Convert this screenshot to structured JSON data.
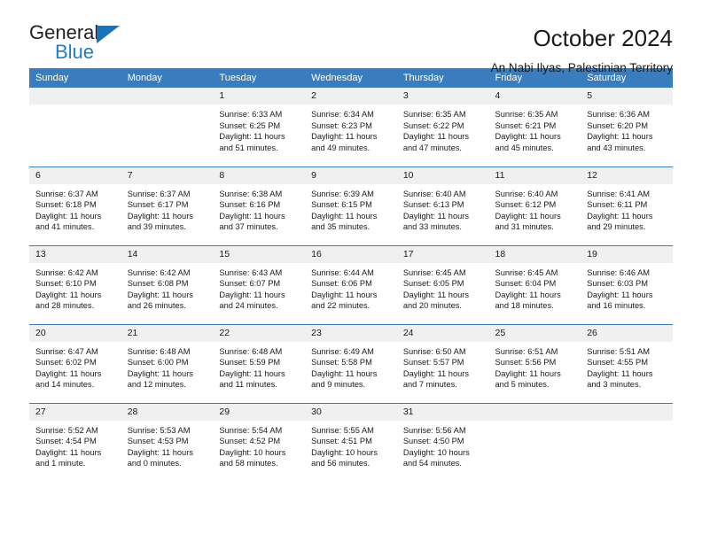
{
  "logo": {
    "word_one": "General",
    "word_two": "Blue",
    "triangle_icon": "blue-triangle-icon"
  },
  "header": {
    "title": "October 2024",
    "subtitle": "An Nabi Ilyas, Palestinian Territory"
  },
  "colors": {
    "header_blue": "#3a7dbf",
    "logo_blue": "#1f7dc4",
    "daynum_band": "#f0f0f0",
    "text": "#1a1a1a"
  },
  "weekday_headers": [
    "Sunday",
    "Monday",
    "Tuesday",
    "Wednesday",
    "Thursday",
    "Friday",
    "Saturday"
  ],
  "weeks": [
    [
      {
        "day": "",
        "info": ""
      },
      {
        "day": "",
        "info": ""
      },
      {
        "day": "1",
        "info": "Sunrise: 6:33 AM\nSunset: 6:25 PM\nDaylight: 11 hours\nand 51 minutes."
      },
      {
        "day": "2",
        "info": "Sunrise: 6:34 AM\nSunset: 6:23 PM\nDaylight: 11 hours\nand 49 minutes."
      },
      {
        "day": "3",
        "info": "Sunrise: 6:35 AM\nSunset: 6:22 PM\nDaylight: 11 hours\nand 47 minutes."
      },
      {
        "day": "4",
        "info": "Sunrise: 6:35 AM\nSunset: 6:21 PM\nDaylight: 11 hours\nand 45 minutes."
      },
      {
        "day": "5",
        "info": "Sunrise: 6:36 AM\nSunset: 6:20 PM\nDaylight: 11 hours\nand 43 minutes."
      }
    ],
    [
      {
        "day": "6",
        "info": "Sunrise: 6:37 AM\nSunset: 6:18 PM\nDaylight: 11 hours\nand 41 minutes."
      },
      {
        "day": "7",
        "info": "Sunrise: 6:37 AM\nSunset: 6:17 PM\nDaylight: 11 hours\nand 39 minutes."
      },
      {
        "day": "8",
        "info": "Sunrise: 6:38 AM\nSunset: 6:16 PM\nDaylight: 11 hours\nand 37 minutes."
      },
      {
        "day": "9",
        "info": "Sunrise: 6:39 AM\nSunset: 6:15 PM\nDaylight: 11 hours\nand 35 minutes."
      },
      {
        "day": "10",
        "info": "Sunrise: 6:40 AM\nSunset: 6:13 PM\nDaylight: 11 hours\nand 33 minutes."
      },
      {
        "day": "11",
        "info": "Sunrise: 6:40 AM\nSunset: 6:12 PM\nDaylight: 11 hours\nand 31 minutes."
      },
      {
        "day": "12",
        "info": "Sunrise: 6:41 AM\nSunset: 6:11 PM\nDaylight: 11 hours\nand 29 minutes."
      }
    ],
    [
      {
        "day": "13",
        "info": "Sunrise: 6:42 AM\nSunset: 6:10 PM\nDaylight: 11 hours\nand 28 minutes."
      },
      {
        "day": "14",
        "info": "Sunrise: 6:42 AM\nSunset: 6:08 PM\nDaylight: 11 hours\nand 26 minutes."
      },
      {
        "day": "15",
        "info": "Sunrise: 6:43 AM\nSunset: 6:07 PM\nDaylight: 11 hours\nand 24 minutes."
      },
      {
        "day": "16",
        "info": "Sunrise: 6:44 AM\nSunset: 6:06 PM\nDaylight: 11 hours\nand 22 minutes."
      },
      {
        "day": "17",
        "info": "Sunrise: 6:45 AM\nSunset: 6:05 PM\nDaylight: 11 hours\nand 20 minutes."
      },
      {
        "day": "18",
        "info": "Sunrise: 6:45 AM\nSunset: 6:04 PM\nDaylight: 11 hours\nand 18 minutes."
      },
      {
        "day": "19",
        "info": "Sunrise: 6:46 AM\nSunset: 6:03 PM\nDaylight: 11 hours\nand 16 minutes."
      }
    ],
    [
      {
        "day": "20",
        "info": "Sunrise: 6:47 AM\nSunset: 6:02 PM\nDaylight: 11 hours\nand 14 minutes."
      },
      {
        "day": "21",
        "info": "Sunrise: 6:48 AM\nSunset: 6:00 PM\nDaylight: 11 hours\nand 12 minutes."
      },
      {
        "day": "22",
        "info": "Sunrise: 6:48 AM\nSunset: 5:59 PM\nDaylight: 11 hours\nand 11 minutes."
      },
      {
        "day": "23",
        "info": "Sunrise: 6:49 AM\nSunset: 5:58 PM\nDaylight: 11 hours\nand 9 minutes."
      },
      {
        "day": "24",
        "info": "Sunrise: 6:50 AM\nSunset: 5:57 PM\nDaylight: 11 hours\nand 7 minutes."
      },
      {
        "day": "25",
        "info": "Sunrise: 6:51 AM\nSunset: 5:56 PM\nDaylight: 11 hours\nand 5 minutes."
      },
      {
        "day": "26",
        "info": "Sunrise: 5:51 AM\nSunset: 4:55 PM\nDaylight: 11 hours\nand 3 minutes."
      }
    ],
    [
      {
        "day": "27",
        "info": "Sunrise: 5:52 AM\nSunset: 4:54 PM\nDaylight: 11 hours\nand 1 minute."
      },
      {
        "day": "28",
        "info": "Sunrise: 5:53 AM\nSunset: 4:53 PM\nDaylight: 11 hours\nand 0 minutes."
      },
      {
        "day": "29",
        "info": "Sunrise: 5:54 AM\nSunset: 4:52 PM\nDaylight: 10 hours\nand 58 minutes."
      },
      {
        "day": "30",
        "info": "Sunrise: 5:55 AM\nSunset: 4:51 PM\nDaylight: 10 hours\nand 56 minutes."
      },
      {
        "day": "31",
        "info": "Sunrise: 5:56 AM\nSunset: 4:50 PM\nDaylight: 10 hours\nand 54 minutes."
      },
      {
        "day": "",
        "info": ""
      },
      {
        "day": "",
        "info": ""
      }
    ]
  ]
}
